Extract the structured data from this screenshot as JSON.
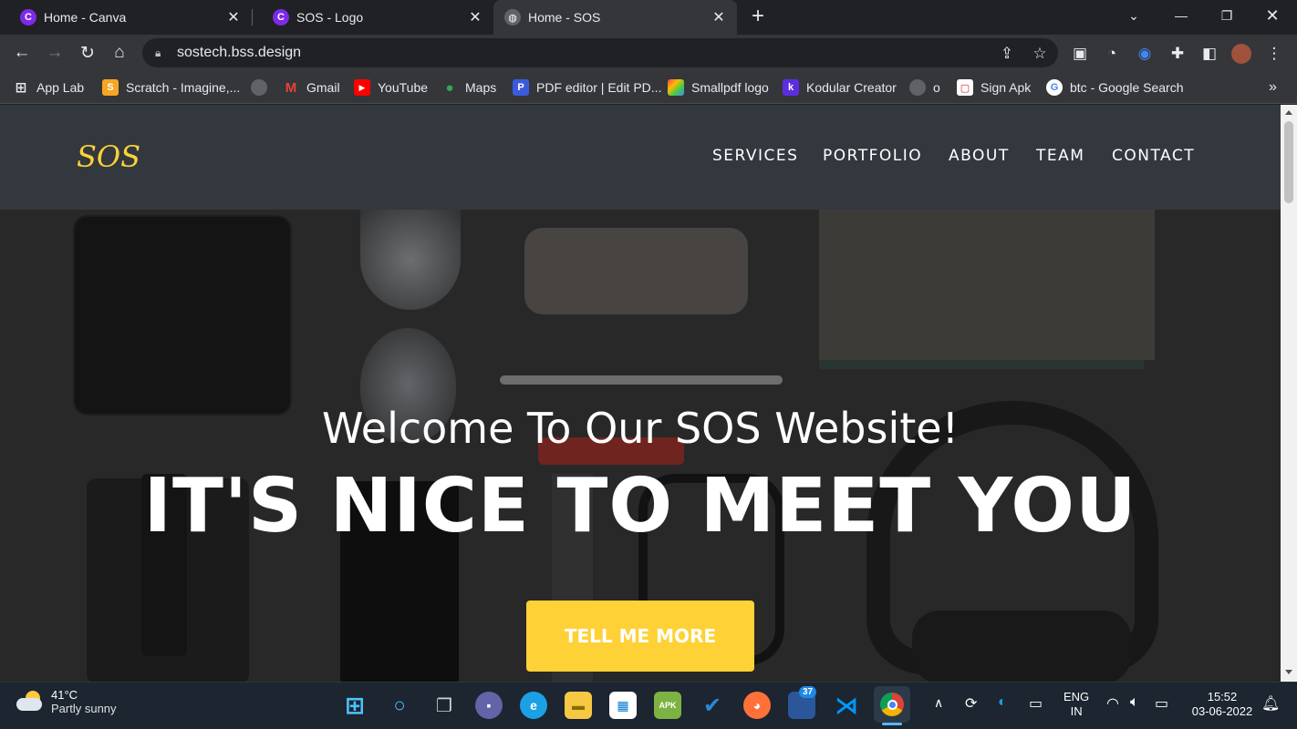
{
  "browser": {
    "tabs": [
      {
        "title": "Home - Canva",
        "icon": "canva-icon"
      },
      {
        "title": "SOS - Logo",
        "icon": "canva-icon"
      },
      {
        "title": "Home - SOS",
        "icon": "globe-icon",
        "active": true
      }
    ],
    "url": "sostech.bss.design",
    "bookmarks": [
      {
        "label": "App Lab",
        "icon": "apps-grid-icon"
      },
      {
        "label": "Scratch - Imagine,...",
        "icon": "scratch-icon"
      },
      {
        "label": "",
        "icon": "globe-icon"
      },
      {
        "label": "Gmail",
        "icon": "gmail-icon"
      },
      {
        "label": "YouTube",
        "icon": "youtube-icon"
      },
      {
        "label": "Maps",
        "icon": "maps-pin-icon"
      },
      {
        "label": "PDF editor | Edit PD...",
        "icon": "pdf-editor-icon"
      },
      {
        "label": "Smallpdf logo",
        "icon": "smallpdf-icon"
      },
      {
        "label": "Kodular Creator",
        "icon": "kodular-icon"
      },
      {
        "label": "o",
        "icon": "globe-icon"
      },
      {
        "label": "Sign Apk",
        "icon": "sign-apk-icon"
      },
      {
        "label": "btc - Google Search",
        "icon": "google-icon"
      }
    ],
    "overflow": "»"
  },
  "site": {
    "brand": "SOS",
    "menu": [
      "SERVICES",
      "PORTFOLIO",
      "ABOUT",
      "TEAM",
      "CONTACT"
    ],
    "hero": {
      "subheading": "Welcome To Our SOS Website!",
      "heading": "IT'S NICE TO MEET YOU",
      "button": "TELL ME MORE"
    },
    "colors": {
      "accent": "#fed136",
      "navbar": "#33383f"
    }
  },
  "taskbar": {
    "weather": {
      "temp": "41°C",
      "condition": "Partly sunny"
    },
    "teams_badge": "37",
    "language": {
      "line1": "ENG",
      "line2": "IN"
    },
    "time": "15:52",
    "date": "03-06-2022"
  }
}
